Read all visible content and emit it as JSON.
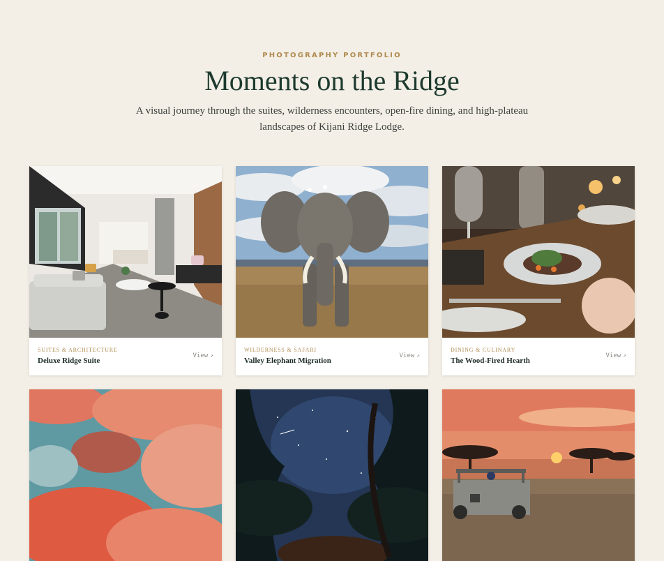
{
  "header": {
    "eyebrow": "PHOTOGRAPHY PORTFOLIO",
    "title": "Moments on the Ridge",
    "subtitle": "A visual journey through the suites, wilderness encounters, open-fire dining, and high-plateau landscapes of Kijani Ridge Lodge."
  },
  "colors": {
    "background": "#f3efe6",
    "accent": "#b08a4f",
    "title": "#1d3a2e"
  },
  "gallery": [
    {
      "category": "SUITES & ARCHITECTURE",
      "title": "Deluxe Ridge Suite",
      "view_label": "View",
      "icon": "external-arrow-icon"
    },
    {
      "category": "WILDERNESS & SAFARI",
      "title": "Valley Elephant Migration",
      "view_label": "View",
      "icon": "external-arrow-icon"
    },
    {
      "category": "DINING & CULINARY",
      "title": "The Wood-Fired Hearth",
      "view_label": "View",
      "icon": "external-arrow-icon"
    },
    {
      "category": "",
      "title": "",
      "view_label": "",
      "icon": ""
    },
    {
      "category": "",
      "title": "",
      "view_label": "",
      "icon": ""
    },
    {
      "category": "",
      "title": "",
      "view_label": "",
      "icon": ""
    }
  ],
  "arrow_glyph": "↗"
}
